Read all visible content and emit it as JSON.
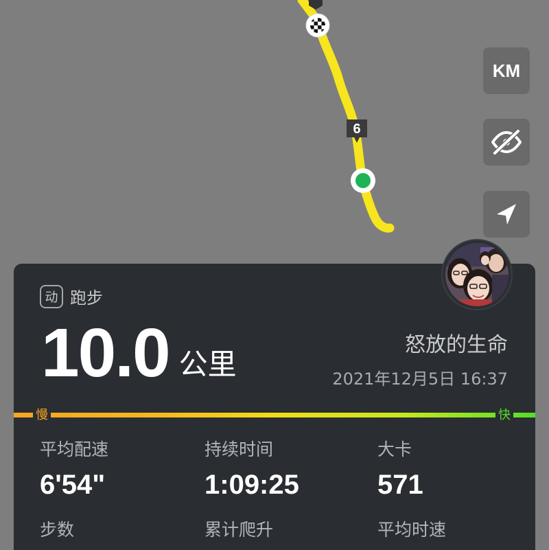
{
  "map": {
    "km_marker": "6",
    "controls": {
      "unit_label": "KM",
      "hide_icon": "eye-slash-icon",
      "locate_icon": "navigation-arrow-icon"
    },
    "route_color": "#f7e51e",
    "start_color": "#1fb257"
  },
  "card": {
    "activity_icon_glyph": "动",
    "activity_type": "跑步",
    "distance": "10.0",
    "distance_unit": "公里",
    "user_name": "怒放的生命",
    "datetime": "2021年12月5日 16:37",
    "speed_slow": "慢",
    "speed_fast": "快",
    "stats": [
      {
        "label": "平均配速",
        "value": "6'54\""
      },
      {
        "label": "持续时间",
        "value": "1:09:25"
      },
      {
        "label": "大卡",
        "value": "571"
      },
      {
        "label": "步数",
        "value": ""
      },
      {
        "label": "累计爬升",
        "value": ""
      },
      {
        "label": "平均时速",
        "value": ""
      }
    ]
  }
}
